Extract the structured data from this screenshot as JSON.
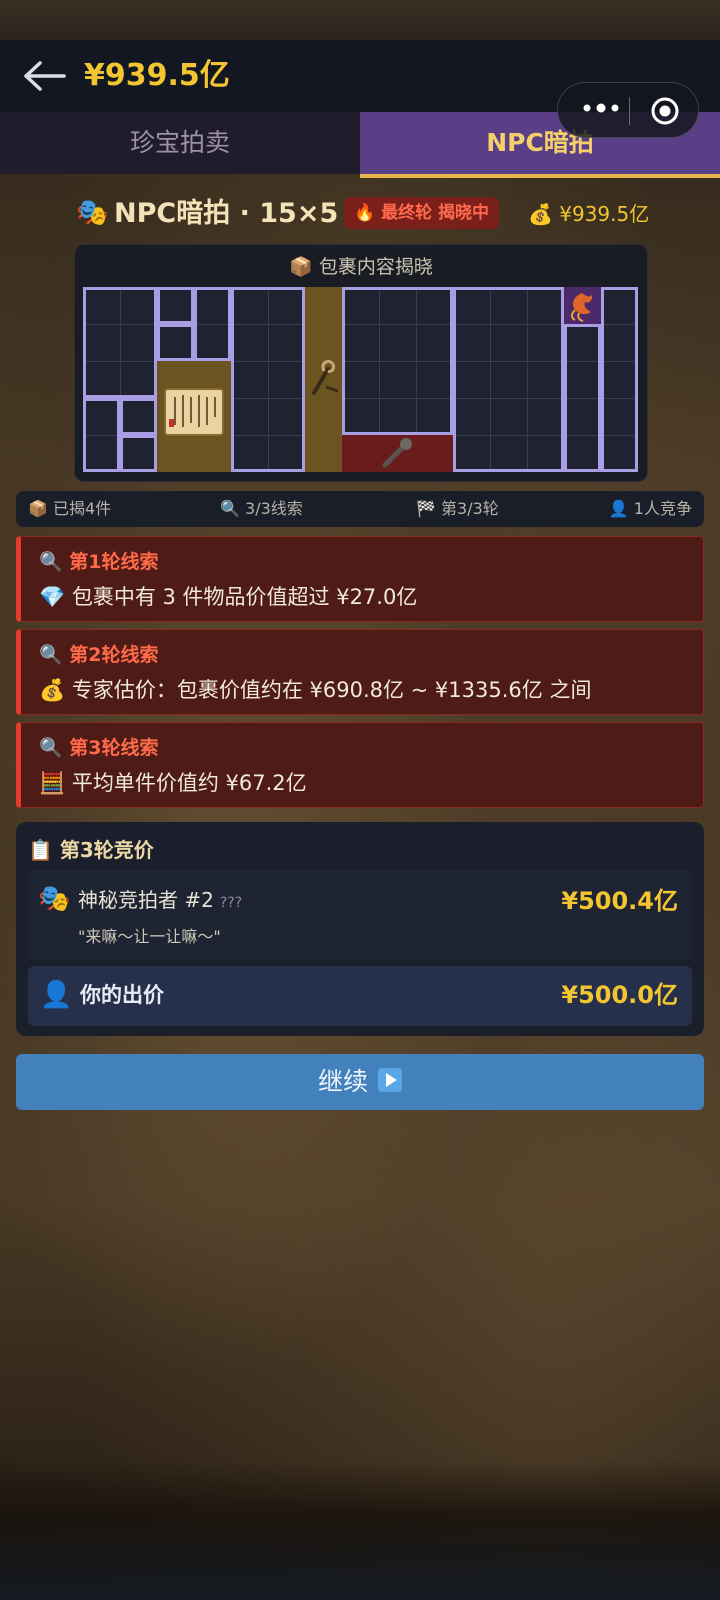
{
  "header": {
    "back_icon": "back-arrow-icon",
    "money": "¥939.5亿"
  },
  "capsule": {
    "more_icon": "more-dots-icon",
    "close_icon": "target-circle-icon"
  },
  "tabs": [
    {
      "label": "珍宝拍卖",
      "active": false
    },
    {
      "label": "NPC暗拍",
      "active": true
    }
  ],
  "game": {
    "title": "NPC暗拍 · 15×5",
    "badge": "🔥 最终轮 揭晓中",
    "money": "💰 ¥939.5亿",
    "mask_icon": "🎭"
  },
  "package": {
    "title": "📦 包裹内容揭晓",
    "grid_cols": 15,
    "grid_rows": 5
  },
  "stats": {
    "revealed": "📦 已揭4件",
    "clues": "🔍 3/3线索",
    "round": "🏁 第3/3轮",
    "bidders": "👤 1人竞争"
  },
  "clues": [
    {
      "title": "🔍 第1轮线索",
      "text": "💎 包裹中有 3 件物品价值超过 ¥27.0亿"
    },
    {
      "title": "🔍 第2轮线索",
      "text": "💰 专家估价：包裹价值约在 ¥690.8亿 ~ ¥1335.6亿 之间"
    },
    {
      "title": "🔍 第3轮线索",
      "text": "🧮 平均单件价值约 ¥67.2亿"
    }
  ],
  "bidding": {
    "title": "📋 第3轮竞价",
    "npc": {
      "icon": "🎭",
      "name": "神秘竞拍者 #2",
      "tag": "???",
      "quote": "\"来嘛～让一让嘛～\"",
      "bid": "¥500.4亿"
    },
    "you": {
      "icon": "👤",
      "label": "你的出价",
      "bid": "¥500.0亿"
    }
  },
  "continue_button": {
    "label": "继续"
  },
  "colors": {
    "gold": "#f2c531",
    "accent_purple": "#5a3f86",
    "clue_red": "#e53b2c",
    "button_blue": "#4281bc"
  }
}
